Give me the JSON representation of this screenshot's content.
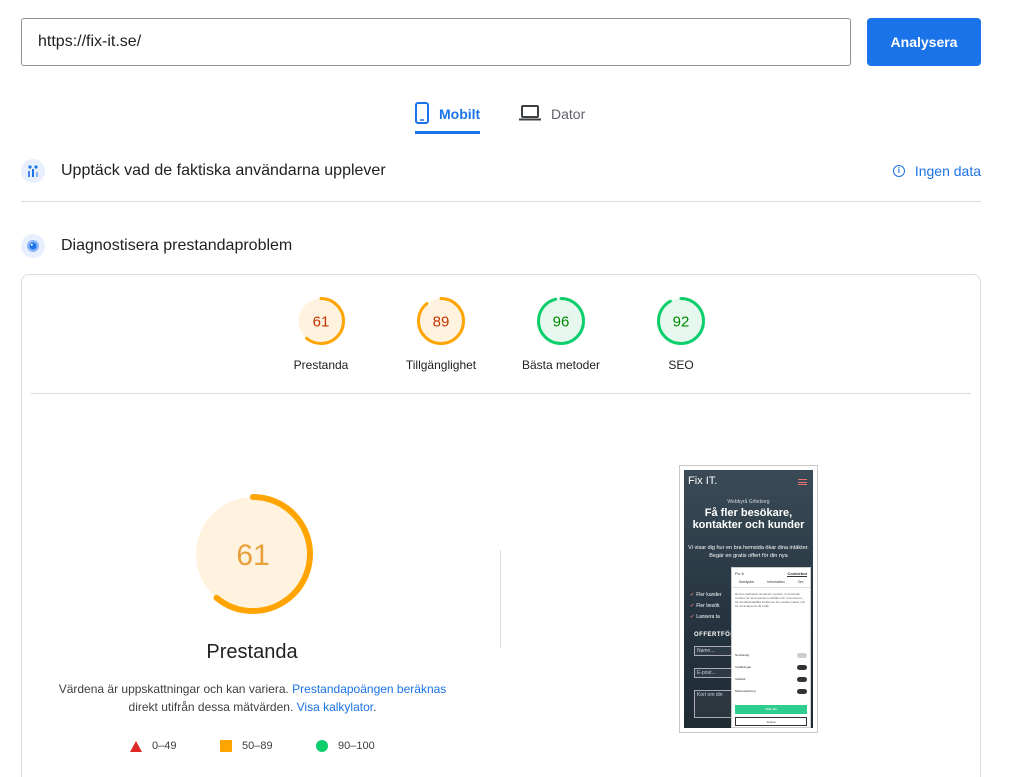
{
  "url_input": {
    "value": "https://fix-it.se/"
  },
  "analyze_button": "Analysera",
  "tabs": [
    {
      "label": "Mobilt",
      "active": true,
      "icon": "smartphone-icon"
    },
    {
      "label": "Dator",
      "active": false,
      "icon": "laptop-icon"
    }
  ],
  "field_data": {
    "title": "Upptäck vad de faktiska användarna upplever",
    "status": "Ingen data",
    "icon": "users-chart-icon"
  },
  "diagnostics": {
    "title": "Diagnostisera prestandaproblem",
    "icon": "lighthouse-icon"
  },
  "scores": [
    {
      "label": "Prestanda",
      "value": 61,
      "color": "#ffa400",
      "text_color": "#c33300",
      "bg": "#fff3e0"
    },
    {
      "label": "Tillgänglighet",
      "value": 89,
      "color": "#ffa400",
      "text_color": "#c33300",
      "bg": "#fff3e0"
    },
    {
      "label": "Bästa metoder",
      "value": 96,
      "color": "#0cce6b",
      "text_color": "#008800",
      "bg": "#e6f8ee"
    },
    {
      "label": "SEO",
      "value": 92,
      "color": "#0cce6b",
      "text_color": "#008800",
      "bg": "#e6f8ee"
    }
  ],
  "main_score": {
    "value": 61,
    "label": "Prestanda",
    "color": "#ffa400",
    "text_color": "#e8a03b"
  },
  "note": {
    "text1": "Värdena är uppskattningar och kan variera.",
    "link1": "Prestandapoängen beräknas",
    "text2": "direkt utifrån dessa mätvärden.",
    "link2": "Visa kalkylator",
    "text3": "."
  },
  "legend": [
    {
      "range": "0–49",
      "shape": "triangle",
      "color": "#e02929"
    },
    {
      "range": "50–89",
      "shape": "square",
      "color": "#ffa400"
    },
    {
      "range": "90–100",
      "shape": "circle",
      "color": "#0cce6b"
    }
  ],
  "phone_preview": {
    "logo": "Fix IT.",
    "small_text": "Webbyrå Göteborg",
    "headline": "Få fler besökare, kontakter och kunder",
    "subtext": "Vi visar dig hur en bra hemsida ökar dina intäkter. Begär en gratis offert för din nya",
    "checks": [
      "Fler kunder",
      "Fler besök",
      "Lansera ta"
    ],
    "offert_heading": "OFFERTFÖR",
    "fields": [
      "Namn...",
      "E-post...",
      "Kort om din"
    ],
    "dialog": {
      "top": "Fix It",
      "logo": "Cookiebot",
      "tabs": [
        "Samtycke",
        "Information",
        "Om"
      ],
      "text": "Denna webbplats använder cookies. Vi använder cookies för att anpassa innehållet och annonserna, för att tillhandahålla funktioner för sociala medier och för att analysera vår trafik.",
      "rows": [
        "Nödvändig",
        "Inställningar",
        "Statistik",
        "Marknadsföring"
      ],
      "btn_primary": "Tillåt alla",
      "btn_secondary": "Avvisa"
    }
  }
}
